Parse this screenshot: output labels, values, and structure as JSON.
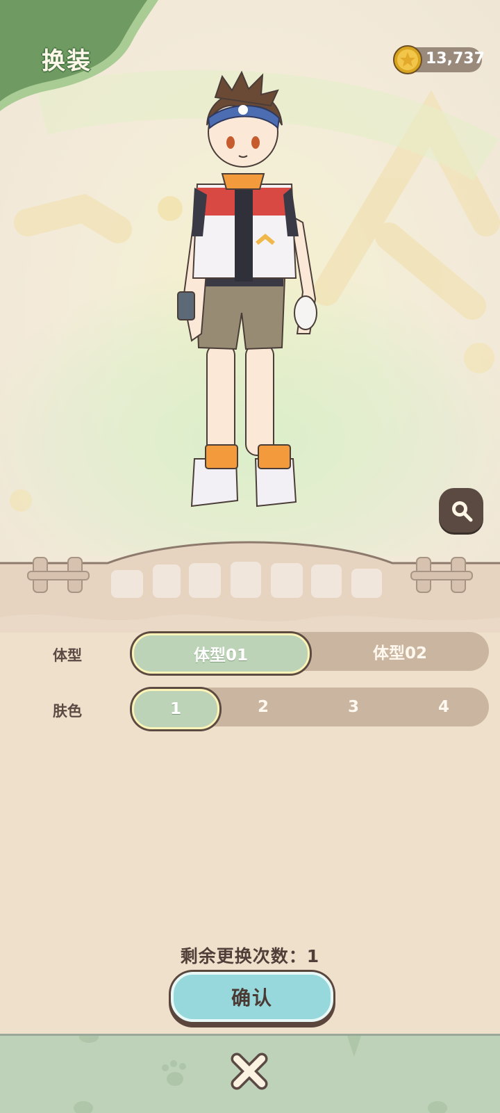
{
  "header": {
    "title": "换装",
    "coins": "13,737",
    "coin_icon": "gold-coin-icon"
  },
  "preview": {
    "zoom_icon": "magnifier-icon"
  },
  "options": {
    "body_type": {
      "label": "体型",
      "choices": [
        "体型01",
        "体型02"
      ],
      "selected": 0
    },
    "skin_color": {
      "label": "肤色",
      "choices": [
        "1",
        "2",
        "3",
        "4"
      ],
      "selected": 0
    }
  },
  "remaining": "剩余更换次数：1",
  "confirm_label": "确认",
  "close_icon": "close-x-icon",
  "colors": {
    "accent_green": "#bcd3b7",
    "confirm_teal": "#97d8dc",
    "panel_bg": "#efe0cc",
    "dark_brown": "#5a4a43"
  }
}
